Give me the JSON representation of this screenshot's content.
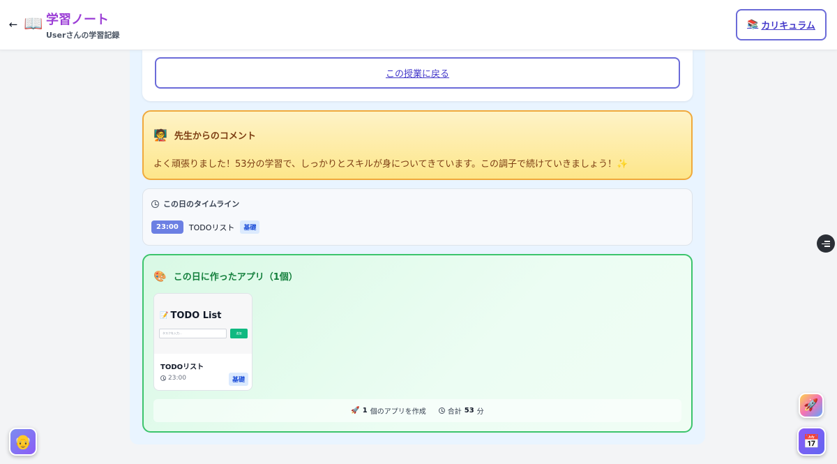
{
  "header": {
    "back_icon": "←",
    "book_icon": "📖",
    "title": "学習ノート",
    "subtitle": "Userさんの学習記録",
    "curriculum_icon": "📚",
    "curriculum_label": "カリキュラム"
  },
  "back_lesson_label": "この授業に戻る",
  "comment": {
    "icon": "🧑‍🏫",
    "heading": "先生からのコメント",
    "text": "よく頑張りました！53分の学習で、しっかりとスキルが身についてきています。この調子で続けていきましょう！✨"
  },
  "timeline": {
    "heading": "この日のタイムライン",
    "items": [
      {
        "time": "23:00",
        "name": "TODOリスト",
        "level": "基礎"
      }
    ]
  },
  "apps": {
    "icon": "🎨",
    "heading": "この日に作ったアプリ（1個）",
    "items": [
      {
        "preview_icon": "📝",
        "preview_title": "TODO List",
        "preview_placeholder": "タスクを入力...",
        "preview_button": "追加",
        "name": "TODOリスト",
        "time": "23:00",
        "level": "基礎"
      }
    ],
    "summary": {
      "rocket_icon": "🚀",
      "count": "1",
      "count_suffix": "個のアプリを作成",
      "total_prefix": "合計",
      "total": "53",
      "total_suffix": "分"
    }
  },
  "floating": {
    "avatar_icon": "👴",
    "rocket_icon": "🚀",
    "calendar_icon": "📅"
  }
}
